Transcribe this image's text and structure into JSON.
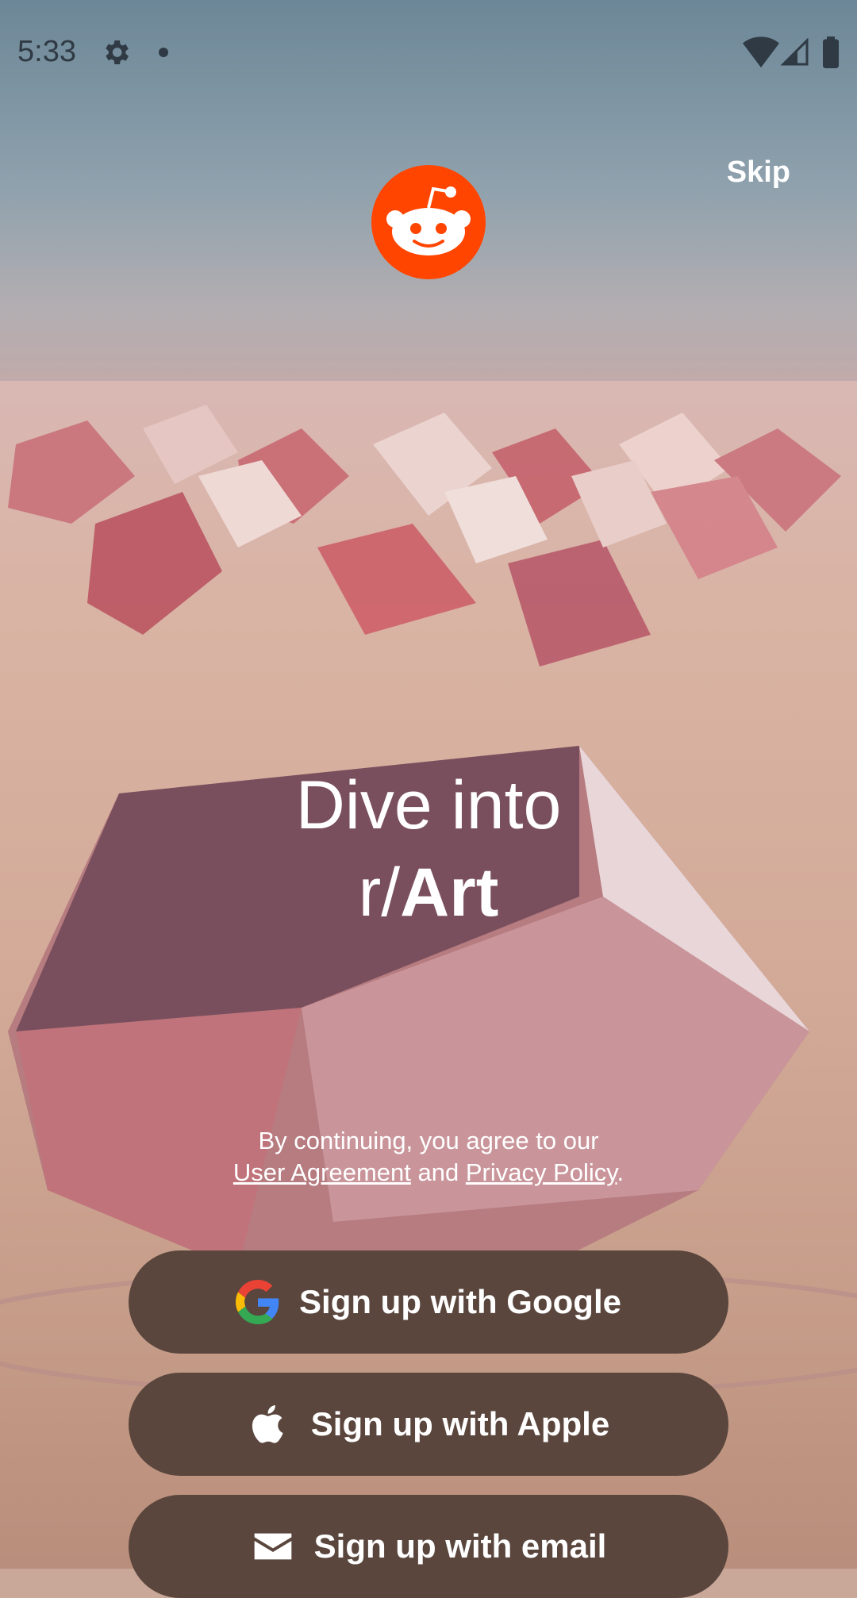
{
  "status_bar": {
    "time": "5:33"
  },
  "header": {
    "skip_label": "Skip",
    "logo_icon": "reddit-snoo-icon",
    "brand_color": "#ff4500"
  },
  "hero": {
    "line1": "Dive into",
    "line2_prefix": "r/",
    "line2_bold": "Art"
  },
  "legal": {
    "line1": "By continuing, you agree to our",
    "user_agreement": "User Agreement",
    "and": "and",
    "privacy_policy": "Privacy Policy",
    "period": "."
  },
  "buttons": {
    "google": {
      "label": "Sign up with Google",
      "icon": "google-g-icon"
    },
    "apple": {
      "label": "Sign up with Apple",
      "icon": "apple-icon"
    },
    "email": {
      "label": "Sign up with email",
      "icon": "envelope-icon"
    }
  },
  "colors": {
    "button_bg": "#5a463d",
    "text": "#ffffff"
  }
}
